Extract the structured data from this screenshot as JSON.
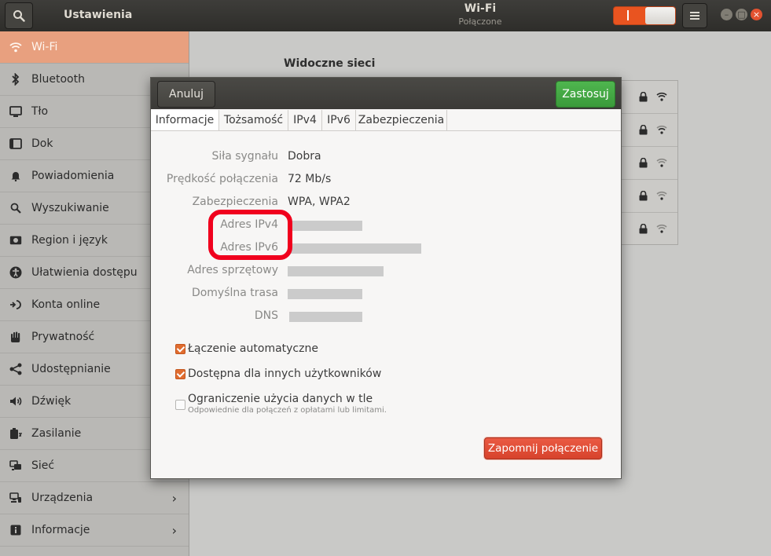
{
  "header": {
    "app_title": "Ustawienia",
    "window_title": "Wi-Fi",
    "window_subtitle": "Połączone",
    "wifi_toggle_on": true,
    "toggle_mark": "|"
  },
  "sidebar": {
    "items": [
      {
        "label": "Wi-Fi",
        "icon": "wifi-icon",
        "active": true
      },
      {
        "label": "Bluetooth",
        "icon": "bluetooth-icon"
      },
      {
        "label": "Tło",
        "icon": "background-icon"
      },
      {
        "label": "Dok",
        "icon": "dock-icon"
      },
      {
        "label": "Powiadomienia",
        "icon": "bell-icon"
      },
      {
        "label": "Wyszukiwanie",
        "icon": "search-icon"
      },
      {
        "label": "Region i język",
        "icon": "region-icon"
      },
      {
        "label": "Ułatwienia dostępu",
        "icon": "accessibility-icon"
      },
      {
        "label": "Konta online",
        "icon": "online-accounts-icon"
      },
      {
        "label": "Prywatność",
        "icon": "hand-icon"
      },
      {
        "label": "Udostępnianie",
        "icon": "share-icon"
      },
      {
        "label": "Dźwięk",
        "icon": "speaker-icon"
      },
      {
        "label": "Zasilanie",
        "icon": "power-icon"
      },
      {
        "label": "Sieć",
        "icon": "network-icon"
      },
      {
        "label": "Urządzenia",
        "icon": "devices-icon",
        "chevron": "›"
      },
      {
        "label": "Informacje",
        "icon": "info-icon",
        "chevron": "›"
      }
    ]
  },
  "main": {
    "visible_networks_title": "Widoczne sieci"
  },
  "dialog": {
    "cancel_label": "Anuluj",
    "apply_label": "Zastosuj",
    "tabs": [
      "Informacje",
      "Tożsamość",
      "IPv4",
      "IPv6",
      "Zabezpieczenia"
    ],
    "active_tab": "Informacje",
    "info": {
      "signal_label": "Siła sygnału",
      "signal_value": "Dobra",
      "speed_label": "Prędkość połączenia",
      "speed_value": "72 Mb/s",
      "security_label": "Zabezpieczenia",
      "security_value": "WPA, WPA2",
      "ipv4_label": "Adres IPv4",
      "ipv6_label": "Adres IPv6",
      "hw_label": "Adres sprzętowy",
      "route_label": "Domyślna trasa",
      "dns_label": "DNS"
    },
    "options": {
      "auto_connect_label": "Łączenie automatyczne",
      "auto_connect_checked": true,
      "available_all_label": "Dostępna dla innych użytkowników",
      "available_all_checked": true,
      "restrict_bg_label": "Ograniczenie użycia danych w tle",
      "restrict_bg_sub": "Odpowiednie dla połączeń z opłatami lub limitami.",
      "restrict_bg_checked": false
    },
    "forget_label": "Zapomnij połączenie"
  },
  "colors": {
    "accent": "#e95420",
    "apply_green": "#3a9a3a",
    "forget_red": "#d7432c",
    "highlight_red": "#f0001d"
  }
}
